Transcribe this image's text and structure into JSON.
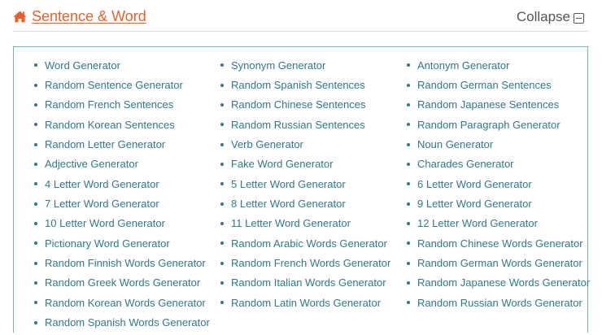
{
  "header": {
    "title": "Sentence & Word",
    "collapse_label": "Collapse"
  },
  "colors": {
    "title": "#e8612c",
    "link": "#2f7a87",
    "panel_border": "#6bbab8"
  },
  "icons": {
    "home": "home-icon",
    "collapse": "minus-square-icon"
  },
  "links": [
    "Word Generator",
    "Synonym Generator",
    "Antonym Generator",
    "Random Sentence Generator",
    "Random Spanish Sentences",
    "Random German Sentences",
    "Random French Sentences",
    "Random Chinese Sentences",
    "Random Japanese Sentences",
    "Random Korean Sentences",
    "Random Russian Sentences",
    "Random Paragraph Generator",
    "Random Letter Generator",
    "Verb Generator",
    "Noun Generator",
    "Adjective Generator",
    "Fake Word Generator",
    "Charades Generator",
    "4 Letter Word Generator",
    "5 Letter Word Generator",
    "6 Letter Word Generator",
    "7 Letter Word Generator",
    "8 Letter Word Generator",
    "9 Letter Word Generator",
    "10 Letter Word Generator",
    "11 Letter Word Generator",
    "12 Letter Word Generator",
    "Pictionary Word Generator",
    "Random Arabic Words Generator",
    "Random Chinese Words Generator",
    "Random Finnish Words Generator",
    "Random French Words Generator",
    "Random German Words Generator",
    "Random Greek Words Generator",
    "Random Italian Words Generator",
    "Random Japanese Words Generator",
    "Random Korean Words Generator",
    "Random Latin Words Generator",
    "Random Russian Words Generator",
    "Random Spanish Words Generator"
  ]
}
